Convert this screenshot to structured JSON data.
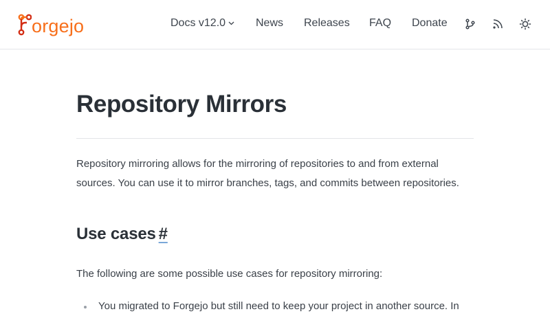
{
  "header": {
    "logo_text": "orgejo",
    "logo_alt": "Forgejo",
    "nav": {
      "docs": "Docs v12.0",
      "news": "News",
      "releases": "Releases",
      "faq": "FAQ",
      "donate": "Donate"
    },
    "icons": [
      "git-branch-icon",
      "rss-icon",
      "sun-icon"
    ]
  },
  "main": {
    "title": "Repository Mirrors",
    "intro": "Repository mirroring allows for the mirroring of repositories to and from external sources. You can use it to mirror branches, tags, and commits between repositories.",
    "section_title": "Use cases",
    "section_anchor": "#",
    "section_intro": "The following are some possible use cases for repository mirroring:",
    "list": [
      "You migrated to Forgejo but still need to keep your project in another source. In"
    ]
  },
  "colors": {
    "brand": "#f76f1b",
    "brand_dark": "#d32d14",
    "text": "#2b3138"
  }
}
